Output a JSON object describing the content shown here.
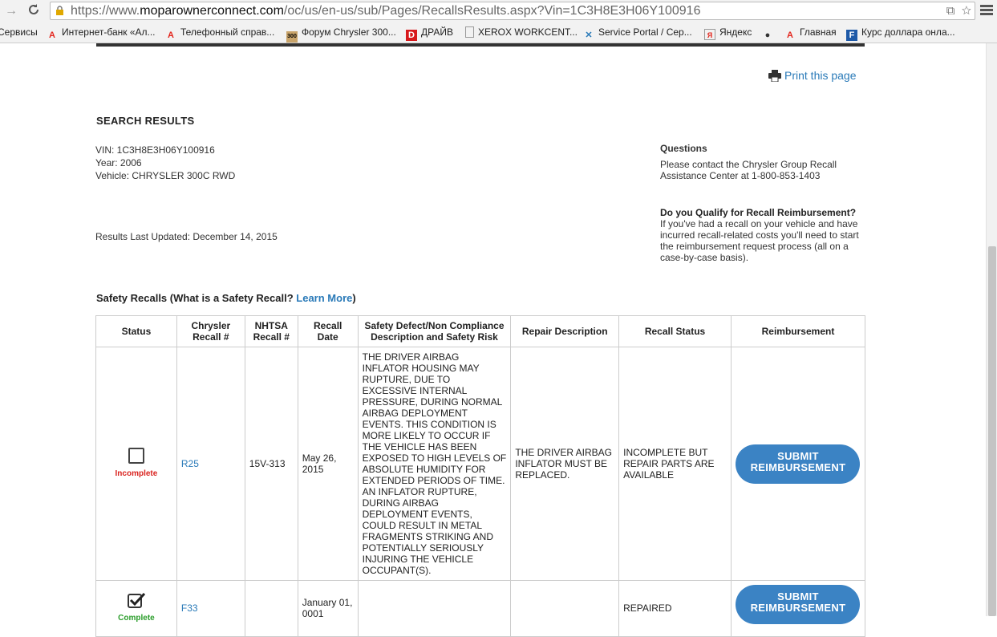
{
  "browser": {
    "url_prefix": "https://www.",
    "url_domain": "moparownerconnect.com",
    "url_path": "/oc/us/en-us/sub/Pages/RecallsResults.aspx?Vin=1C3H8E3H06Y100916",
    "bookmarks": [
      {
        "label": "Сервисы",
        "icon": "apps-icon"
      },
      {
        "label": "Интернет-банк «Ал...",
        "icon": "alfa-icon"
      },
      {
        "label": "Телефонный справ...",
        "icon": "alfa-icon"
      },
      {
        "label": "Форум Chrysler 300...",
        "icon": "forum-icon"
      },
      {
        "label": "ДРАЙВ",
        "icon": "drive-icon"
      },
      {
        "label": "XEROX WORKCENT...",
        "icon": "page-icon"
      },
      {
        "label": "Service Portal / Сер...",
        "icon": "tools-icon"
      },
      {
        "label": "Яндекс",
        "icon": "yandex-icon"
      },
      {
        "label": "",
        "icon": "bulb-icon"
      },
      {
        "label": "Главная",
        "icon": "alfa-icon"
      },
      {
        "label": "Курс доллара онла...",
        "icon": "rate-icon"
      }
    ]
  },
  "page": {
    "print_label": "Print this page",
    "title": "SEARCH RESULTS",
    "vin": "VIN: 1C3H8E3H06Y100916",
    "year": "Year: 2006",
    "vehicle": "Vehicle: CHRYSLER 300C RWD",
    "updated": "Results Last Updated: December 14, 2015",
    "questions_title": "Questions",
    "questions_text": "Please contact the Chrysler Group Recall Assistance Center at 1-800-853-1403",
    "reimb_title": "Do you Qualify for Recall Reimbursement?",
    "reimb_text": "If you've had a recall on your vehicle and have incurred recall-related costs you'll need to start the reimbursement request process (all on a case-by-case basis).",
    "section_prefix": "Safety Recalls (What is a Safety Recall? ",
    "section_link": "Learn More",
    "section_suffix": ")"
  },
  "table": {
    "headers": [
      "Status",
      "Chrysler Recall #",
      "NHTSA Recall #",
      "Recall Date",
      "Safety Defect/Non Compliance Description and Safety Risk",
      "Repair Description",
      "Recall Status",
      "Reimbursement"
    ],
    "rows": [
      {
        "status": "Incomplete",
        "chrysler": "R25",
        "nhtsa": "15V-313",
        "date": "May 26, 2015",
        "defect": "THE DRIVER AIRBAG INFLATOR HOUSING MAY RUPTURE, DUE TO EXCESSIVE INTERNAL PRESSURE, DURING NORMAL AIRBAG DEPLOYMENT EVENTS. THIS CONDITION IS MORE LIKELY TO OCCUR IF THE VEHICLE HAS BEEN EXPOSED TO HIGH LEVELS OF ABSOLUTE HUMIDITY FOR EXTENDED PERIODS OF TIME. AN INFLATOR RUPTURE, DURING AIRBAG DEPLOYMENT EVENTS, COULD RESULT IN METAL FRAGMENTS STRIKING AND POTENTIALLY SERIOUSLY INJURING THE VEHICLE OCCUPANT(S).",
        "repair": "THE DRIVER AIRBAG INFLATOR MUST BE REPLACED.",
        "recall_status": "INCOMPLETE BUT REPAIR PARTS ARE AVAILABLE",
        "button": "SUBMIT REIMBURSEMENT"
      },
      {
        "status": "Complete",
        "chrysler": "F33",
        "nhtsa": "",
        "date": "January 01, 0001",
        "defect": "",
        "repair": "",
        "recall_status": "REPAIRED",
        "button": "SUBMIT REIMBURSEMENT"
      }
    ]
  }
}
